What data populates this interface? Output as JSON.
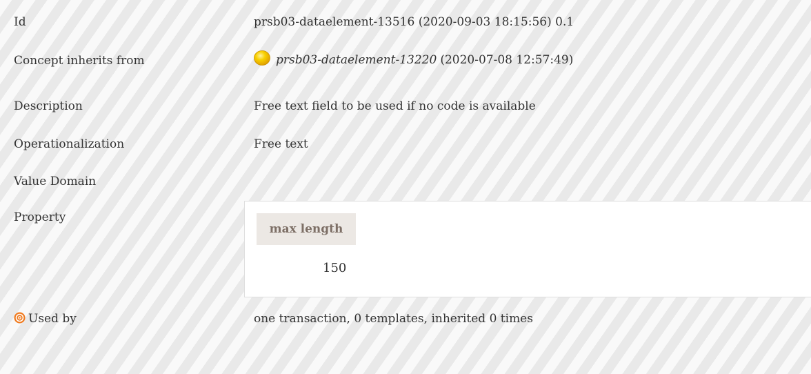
{
  "rows": {
    "id": {
      "label": "Id",
      "value": "prsb03-dataelement-13516 (2020-09-03 18:15:56) 0.1"
    },
    "inherits": {
      "label": "Concept inherits from",
      "concept": "prsb03-dataelement-13220",
      "date": "(2020-07-08 12:57:49)",
      "icon": "yellow-circle-icon"
    },
    "description": {
      "label": "Description",
      "value": "Free text field to be used if no code is available"
    },
    "operationalization": {
      "label": "Operationalization",
      "value": "Free text"
    },
    "value_domain": {
      "label": "Value Domain"
    },
    "property": {
      "label": "Property",
      "header": "max length",
      "value": "150"
    },
    "used_by": {
      "label": "Used by",
      "value": "one transaction, 0 templates, inherited 0 times",
      "icon": "target-icon"
    }
  },
  "colors": {
    "accent_yellow": "#f5c400",
    "target_orange": "#f07a1e",
    "header_bg": "#ece8e4",
    "header_text": "#7d6f66"
  }
}
